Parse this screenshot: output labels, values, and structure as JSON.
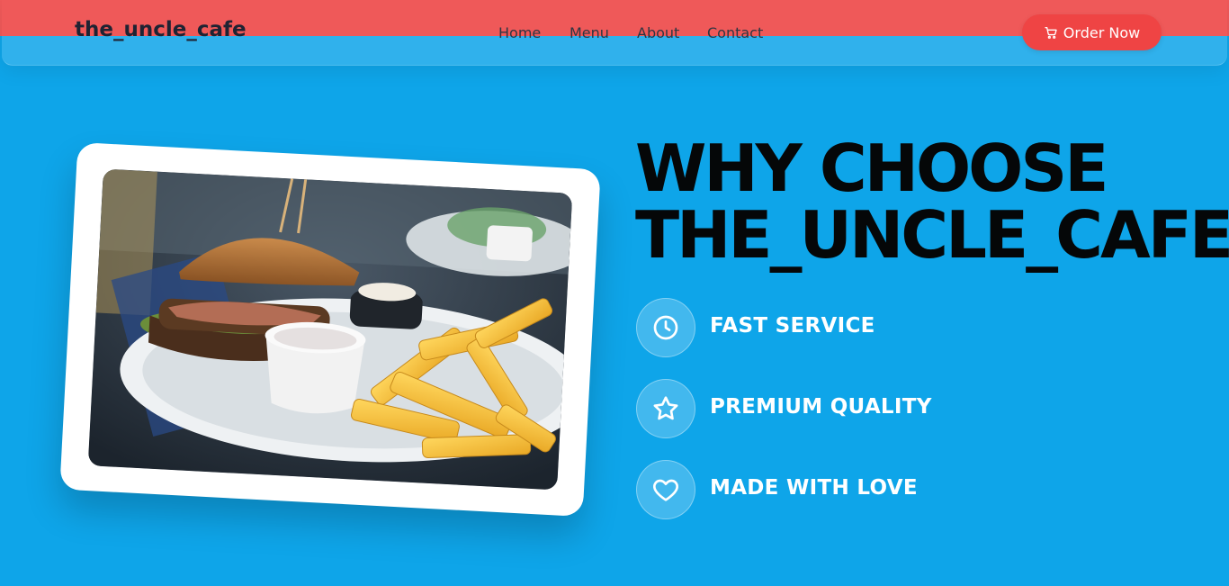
{
  "header": {
    "brand": "the_uncle_cafe",
    "nav": [
      "Home",
      "Menu",
      "About",
      "Contact"
    ],
    "order_button": {
      "label": "Order Now",
      "icon": "cart-icon"
    }
  },
  "hero": {
    "image": "burger-and-fries-photo",
    "headline_line1": "WHY CHOOSE",
    "headline_line2": "THE_UNCLE_CAFE?",
    "features": [
      {
        "icon": "clock-icon",
        "label": "FAST SERVICE"
      },
      {
        "icon": "star-icon",
        "label": "PREMIUM QUALITY"
      },
      {
        "icon": "heart-icon",
        "label": "MADE WITH LOVE"
      }
    ]
  },
  "colors": {
    "background": "#0ea5e9",
    "top_strip": "#ef5959",
    "accent_button": "#ef4444",
    "headline": "#050708",
    "feature_text": "#ffffff"
  }
}
